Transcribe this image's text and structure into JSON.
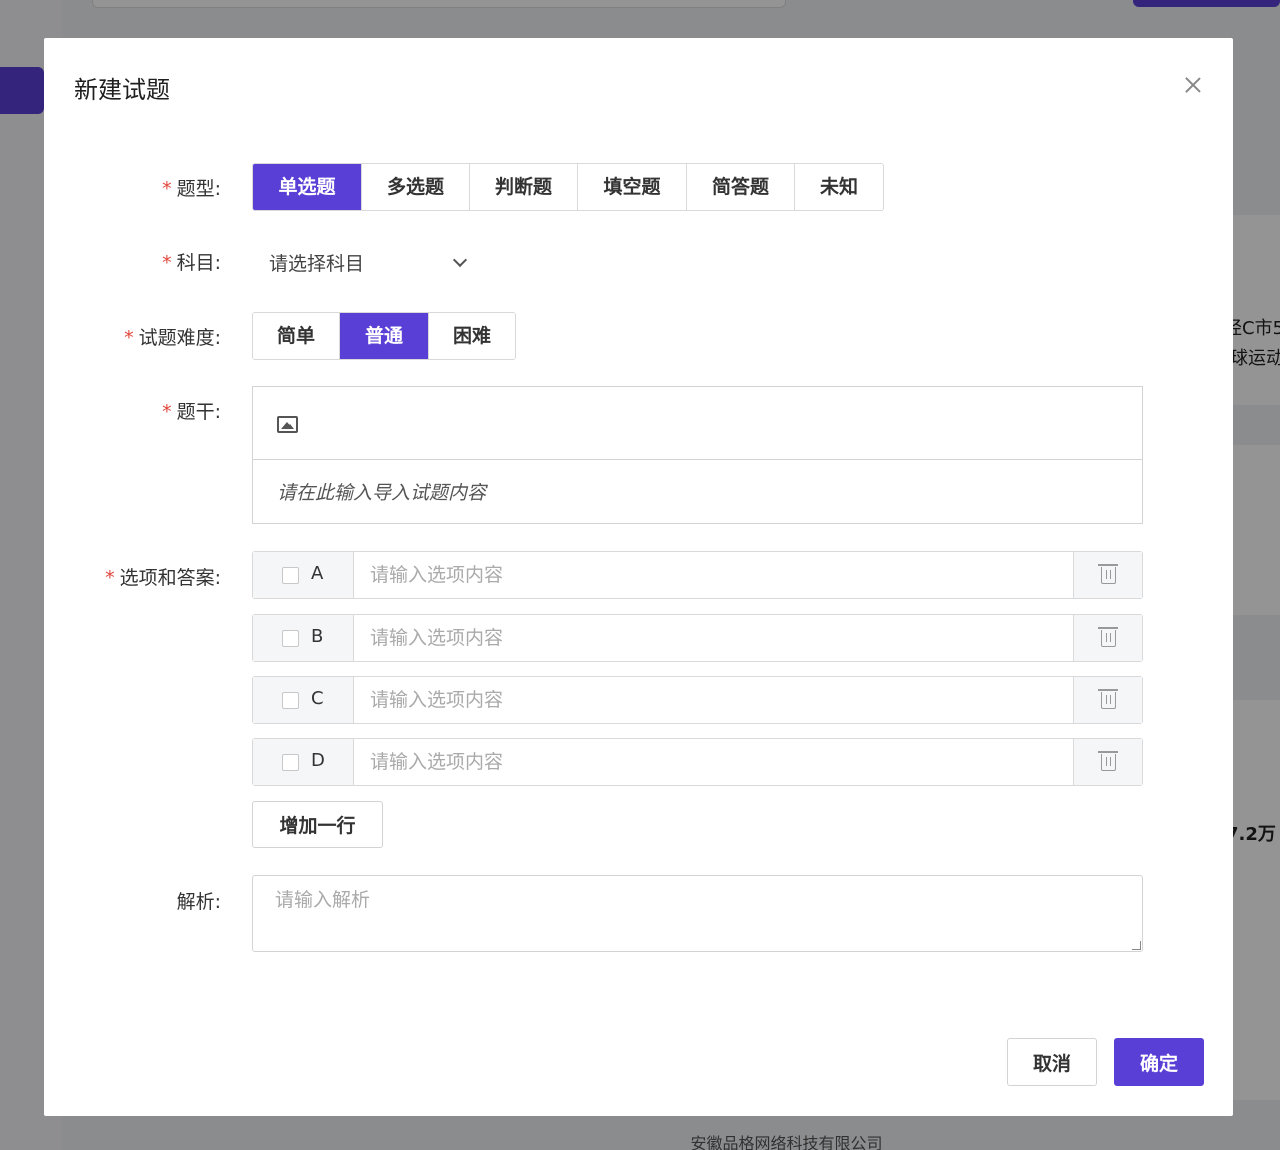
{
  "background": {
    "right_texts": [
      "经C市5",
      "球运动",
      "7.2万"
    ],
    "footer": "安徽品格网络科技有限公司"
  },
  "modal": {
    "title": "新建试题",
    "type": {
      "label": "题型:",
      "options": [
        "单选题",
        "多选题",
        "判断题",
        "填空题",
        "简答题",
        "未知"
      ],
      "selected": "单选题"
    },
    "subject": {
      "label": "科目:",
      "placeholder": "请选择科目"
    },
    "difficulty": {
      "label": "试题难度:",
      "options": [
        "简单",
        "普通",
        "困难"
      ],
      "selected": "普通"
    },
    "stem": {
      "label": "题干:",
      "placeholder": "请在此输入导入试题内容"
    },
    "options": {
      "label": "选项和答案:",
      "rows": [
        {
          "letter": "A",
          "placeholder": "请输入选项内容"
        },
        {
          "letter": "B",
          "placeholder": "请输入选项内容"
        },
        {
          "letter": "C",
          "placeholder": "请输入选项内容"
        },
        {
          "letter": "D",
          "placeholder": "请输入选项内容"
        }
      ],
      "add_row_label": "增加一行"
    },
    "analysis": {
      "label": "解析:",
      "placeholder": "请输入解析"
    },
    "footer": {
      "cancel_label": "取消",
      "ok_label": "确定"
    }
  },
  "colors": {
    "primary": "#5a3fd6",
    "required": "#e0473c"
  }
}
